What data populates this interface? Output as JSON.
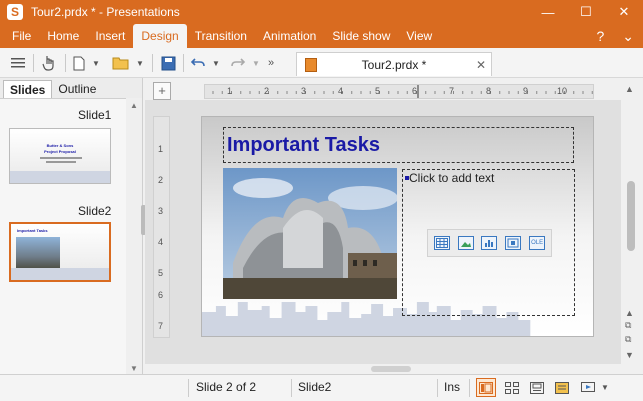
{
  "window": {
    "title": "Tour2.prdx * - Presentations",
    "app_icon_letter": "S",
    "controls": {
      "minimize": "—",
      "maximize": "☐",
      "close": "✕"
    },
    "accent": "#d96b20"
  },
  "menu": {
    "tabs": [
      "File",
      "Home",
      "Insert",
      "Design",
      "Transition",
      "Animation",
      "Slide show",
      "View"
    ],
    "active": "Design",
    "help": "?",
    "collapse": "⌄"
  },
  "toolbar": {
    "overflow": "»",
    "document_tab": {
      "label": "Tour2.prdx *",
      "close": "✕"
    }
  },
  "left_panel": {
    "tabs": [
      "Slides",
      "Outline"
    ],
    "active_tab": "Slides",
    "slides": [
      {
        "label": "Slide1",
        "title": "Butter & Sons",
        "subtitle": "Project Proposal",
        "selected": false
      },
      {
        "label": "Slide2",
        "title": "Important Tasks",
        "selected": true
      }
    ]
  },
  "slide": {
    "title": "Important Tasks",
    "content_placeholder": "Click to add text",
    "insert_icons": [
      "table-icon",
      "picture-icon",
      "chart-icon",
      "media-icon",
      "ole-object-icon"
    ],
    "insert_icon_labels": [
      "",
      "",
      "",
      "",
      "OLE"
    ]
  },
  "ruler": {
    "h_marks": [
      "1",
      "2",
      "3",
      "4",
      "5",
      "6",
      "7",
      "8",
      "9",
      "10"
    ],
    "v_marks": [
      "1",
      "2",
      "3",
      "4",
      "5",
      "6",
      "7"
    ]
  },
  "status": {
    "slide_position": "Slide 2 of 2",
    "slide_name": "Slide2",
    "mode": "Ins"
  }
}
